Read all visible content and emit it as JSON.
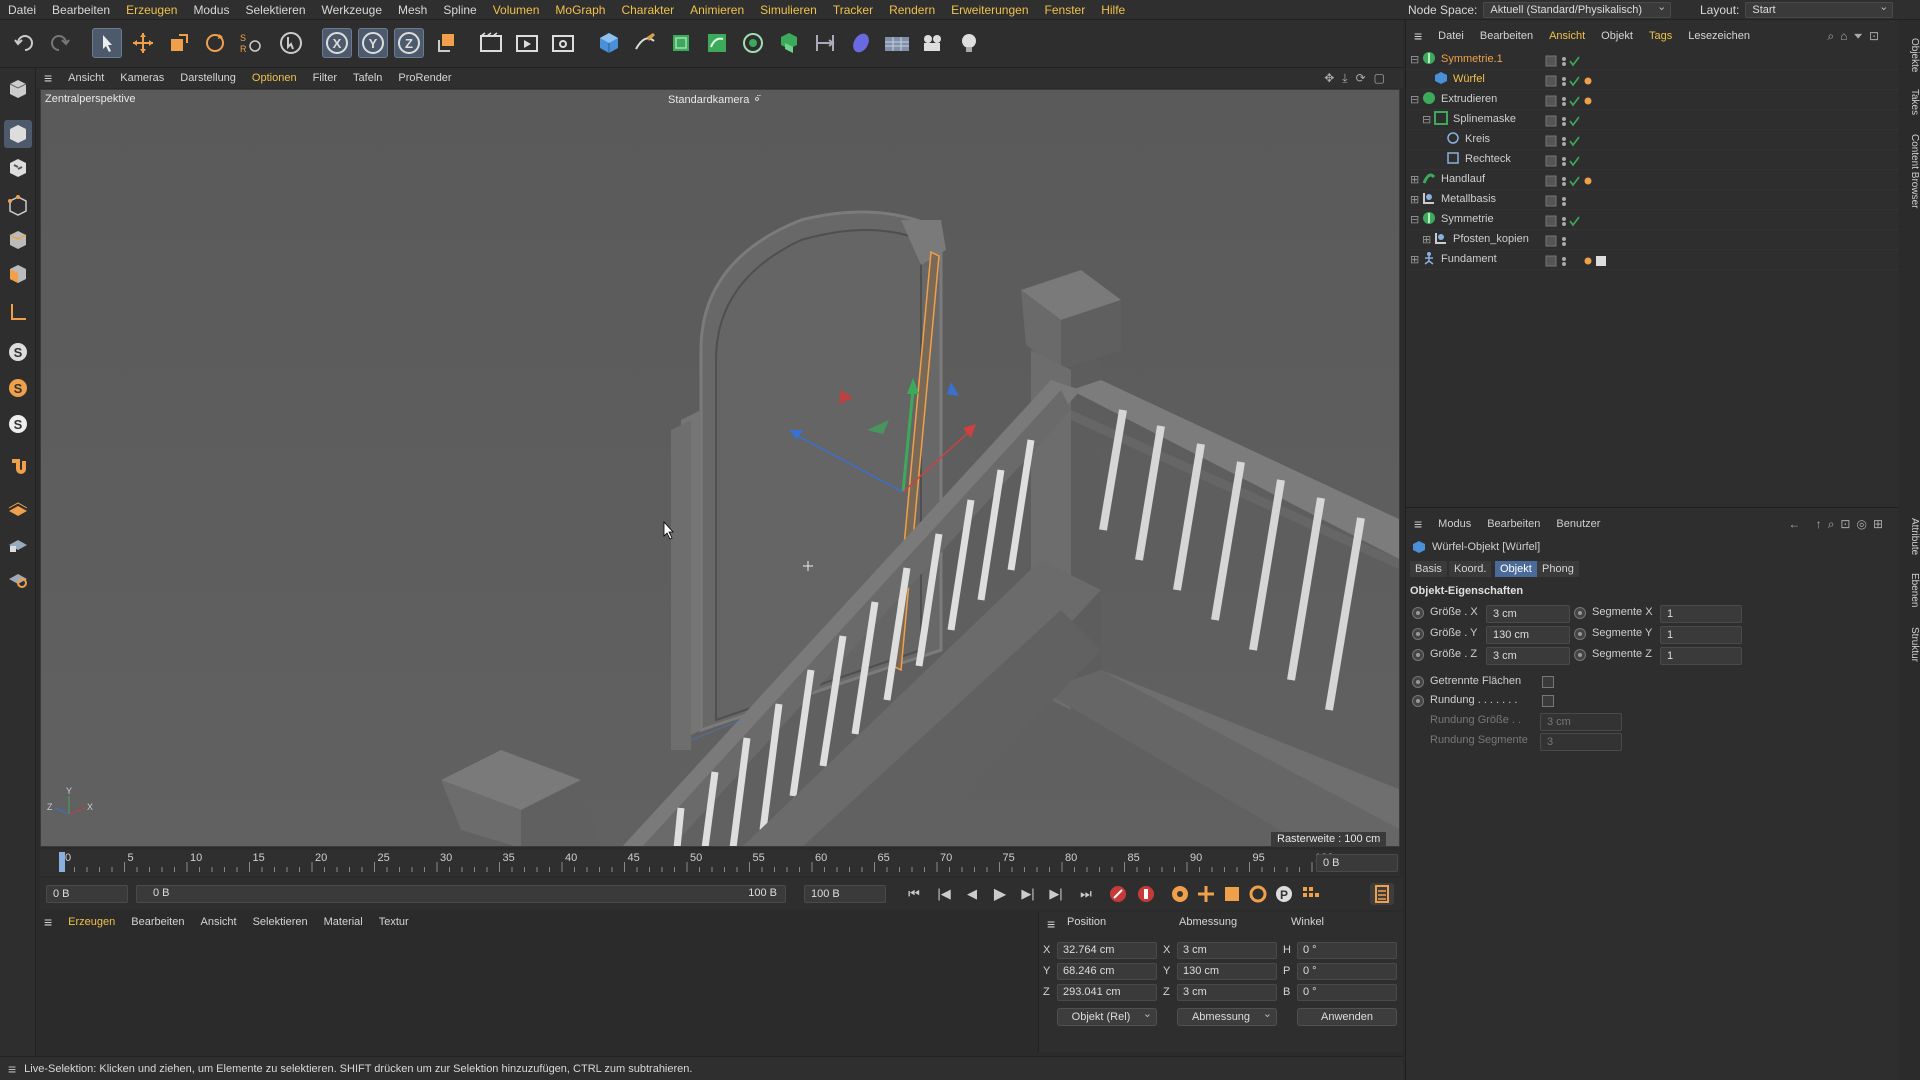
{
  "menubar": {
    "items": [
      "Datei",
      "Bearbeiten",
      "Erzeugen",
      "Modus",
      "Selektieren",
      "Werkzeuge",
      "Mesh",
      "Spline",
      "Volumen",
      "MoGraph",
      "Charakter",
      "Animieren",
      "Simulieren",
      "Tracker",
      "Rendern",
      "Erweiterungen",
      "Fenster",
      "Hilfe"
    ],
    "node_space_label": "Node Space:",
    "node_space_value": "Aktuell (Standard/Physikalisch)",
    "layout_label": "Layout:",
    "layout_value": "Start"
  },
  "toolbar": {
    "icons": [
      "undo-icon",
      "redo-icon",
      "live-selection-icon",
      "move-icon",
      "scale-icon",
      "rotate-icon",
      "recent-tools-icon",
      "model-mode-icon",
      "x-axis-icon",
      "y-axis-icon",
      "z-axis-icon",
      "coordinate-system-icon",
      "render-view-icon",
      "render-picture-viewer-icon",
      "render-settings-icon",
      "cube-icon",
      "pen-icon",
      "subdivision-icon",
      "spline-generator-icon",
      "cloner-icon",
      "mograph-icon",
      "deformer-icon",
      "field-icon",
      "environment-icon",
      "camera-icon",
      "light-icon"
    ],
    "axis_labels": [
      "X",
      "Y",
      "Z"
    ]
  },
  "viewport": {
    "menu": [
      "Ansicht",
      "Kameras",
      "Darstellung",
      "Optionen",
      "Filter",
      "Tafeln",
      "ProRender"
    ],
    "active_menu": "Optionen",
    "perspective_label": "Zentralperspektive",
    "camera_label": "Standardkamera",
    "grid_label": "Rasterweite : 100 cm",
    "axis_x": "X",
    "axis_y": "Y",
    "axis_z": "Z",
    "bg_color": "#5c5c5c"
  },
  "timeline": {
    "ticks": [
      "0",
      "5",
      "10",
      "15",
      "20",
      "25",
      "30",
      "35",
      "40",
      "45",
      "50",
      "55",
      "60",
      "65",
      "70",
      "75",
      "80",
      "85",
      "90",
      "95",
      "100"
    ],
    "current_frame": "0 B",
    "start_field": "0 B",
    "range_start": "0 B",
    "range_end": "100 B",
    "end_field": "100 B"
  },
  "material": {
    "menu": [
      "Erzeugen",
      "Bearbeiten",
      "Ansicht",
      "Selektieren",
      "Material",
      "Textur"
    ],
    "active_menu": "Erzeugen"
  },
  "coords": {
    "headers": [
      "Position",
      "Abmessung",
      "Winkel"
    ],
    "rows": [
      {
        "axis": "X",
        "pos": "32.764 cm",
        "size_axis": "X",
        "size": "3 cm",
        "rot_axis": "H",
        "rot": "0 °"
      },
      {
        "axis": "Y",
        "pos": "68.246 cm",
        "size_axis": "Y",
        "size": "130 cm",
        "rot_axis": "P",
        "rot": "0 °"
      },
      {
        "axis": "Z",
        "pos": "293.041 cm",
        "size_axis": "Z",
        "size": "3 cm",
        "rot_axis": "B",
        "rot": "0 °"
      }
    ],
    "mode_select": "Objekt (Rel)",
    "size_select": "Abmessung",
    "apply_label": "Anwenden"
  },
  "status": {
    "text": "Live-Selektion: Klicken und ziehen, um Elemente zu selektieren. SHIFT drücken um zur Selektion hinzuzufügen, CTRL zum subtrahieren."
  },
  "objects": {
    "menu": [
      "Datei",
      "Bearbeiten",
      "Ansicht",
      "Objekt",
      "Tags",
      "Lesezeichen"
    ],
    "active_menu": "Ansicht",
    "rows": [
      {
        "name": "Symmetrie.1",
        "icon": "symmetry-icon",
        "color": "#f0a04b"
      },
      {
        "name": "Würfel",
        "icon": "cube-icon",
        "color": "#f0c14b"
      },
      {
        "name": "Extrudieren",
        "icon": "extrude-icon",
        "color": "#d8d8d8"
      },
      {
        "name": "Splinemaske",
        "icon": "spline-mask-icon",
        "color": "#d8d8d8"
      },
      {
        "name": "Kreis",
        "icon": "circle-icon",
        "color": "#d8d8d8"
      },
      {
        "name": "Rechteck",
        "icon": "rectangle-icon",
        "color": "#d8d8d8"
      },
      {
        "name": "Handlauf",
        "icon": "sweep-icon",
        "color": "#d8d8d8"
      },
      {
        "name": "Metallbasis",
        "icon": "null-icon",
        "color": "#d8d8d8"
      },
      {
        "name": "Symmetrie",
        "icon": "symmetry-icon",
        "color": "#d8d8d8"
      },
      {
        "name": "Pfosten_kopien",
        "icon": "null-icon",
        "color": "#d8d8d8"
      },
      {
        "name": "Fundament",
        "icon": "figure-icon",
        "color": "#d8d8d8"
      }
    ]
  },
  "attributes": {
    "menu": [
      "Modus",
      "Bearbeiten",
      "Benutzer"
    ],
    "object_title": "Würfel-Objekt [Würfel]",
    "tabs": [
      "Basis",
      "Koord.",
      "Objekt",
      "Phong"
    ],
    "active_tab": "Objekt",
    "section_title": "Objekt-Eigenschaften",
    "size_x_label": "Größe . X",
    "size_x": "3 cm",
    "size_y_label": "Größe . Y",
    "size_y": "130 cm",
    "size_z_label": "Größe . Z",
    "size_z": "3 cm",
    "seg_x_label": "Segmente X",
    "seg_x": "1",
    "seg_y_label": "Segmente Y",
    "seg_y": "1",
    "seg_z_label": "Segmente Z",
    "seg_z": "1",
    "separate_label": "Getrennte Flächen",
    "rounding_label": "Rundung . . . . . . .",
    "rounding_size_label": "Rundung Größe . .",
    "rounding_size": "3 cm",
    "rounding_seg_label": "Rundung Segmente",
    "rounding_seg": "3"
  },
  "sidetabs": {
    "top": [
      "Objekte",
      "Takes",
      "Content Browser"
    ],
    "bottom": [
      "Attribute",
      "Ebenen",
      "Struktur"
    ]
  }
}
